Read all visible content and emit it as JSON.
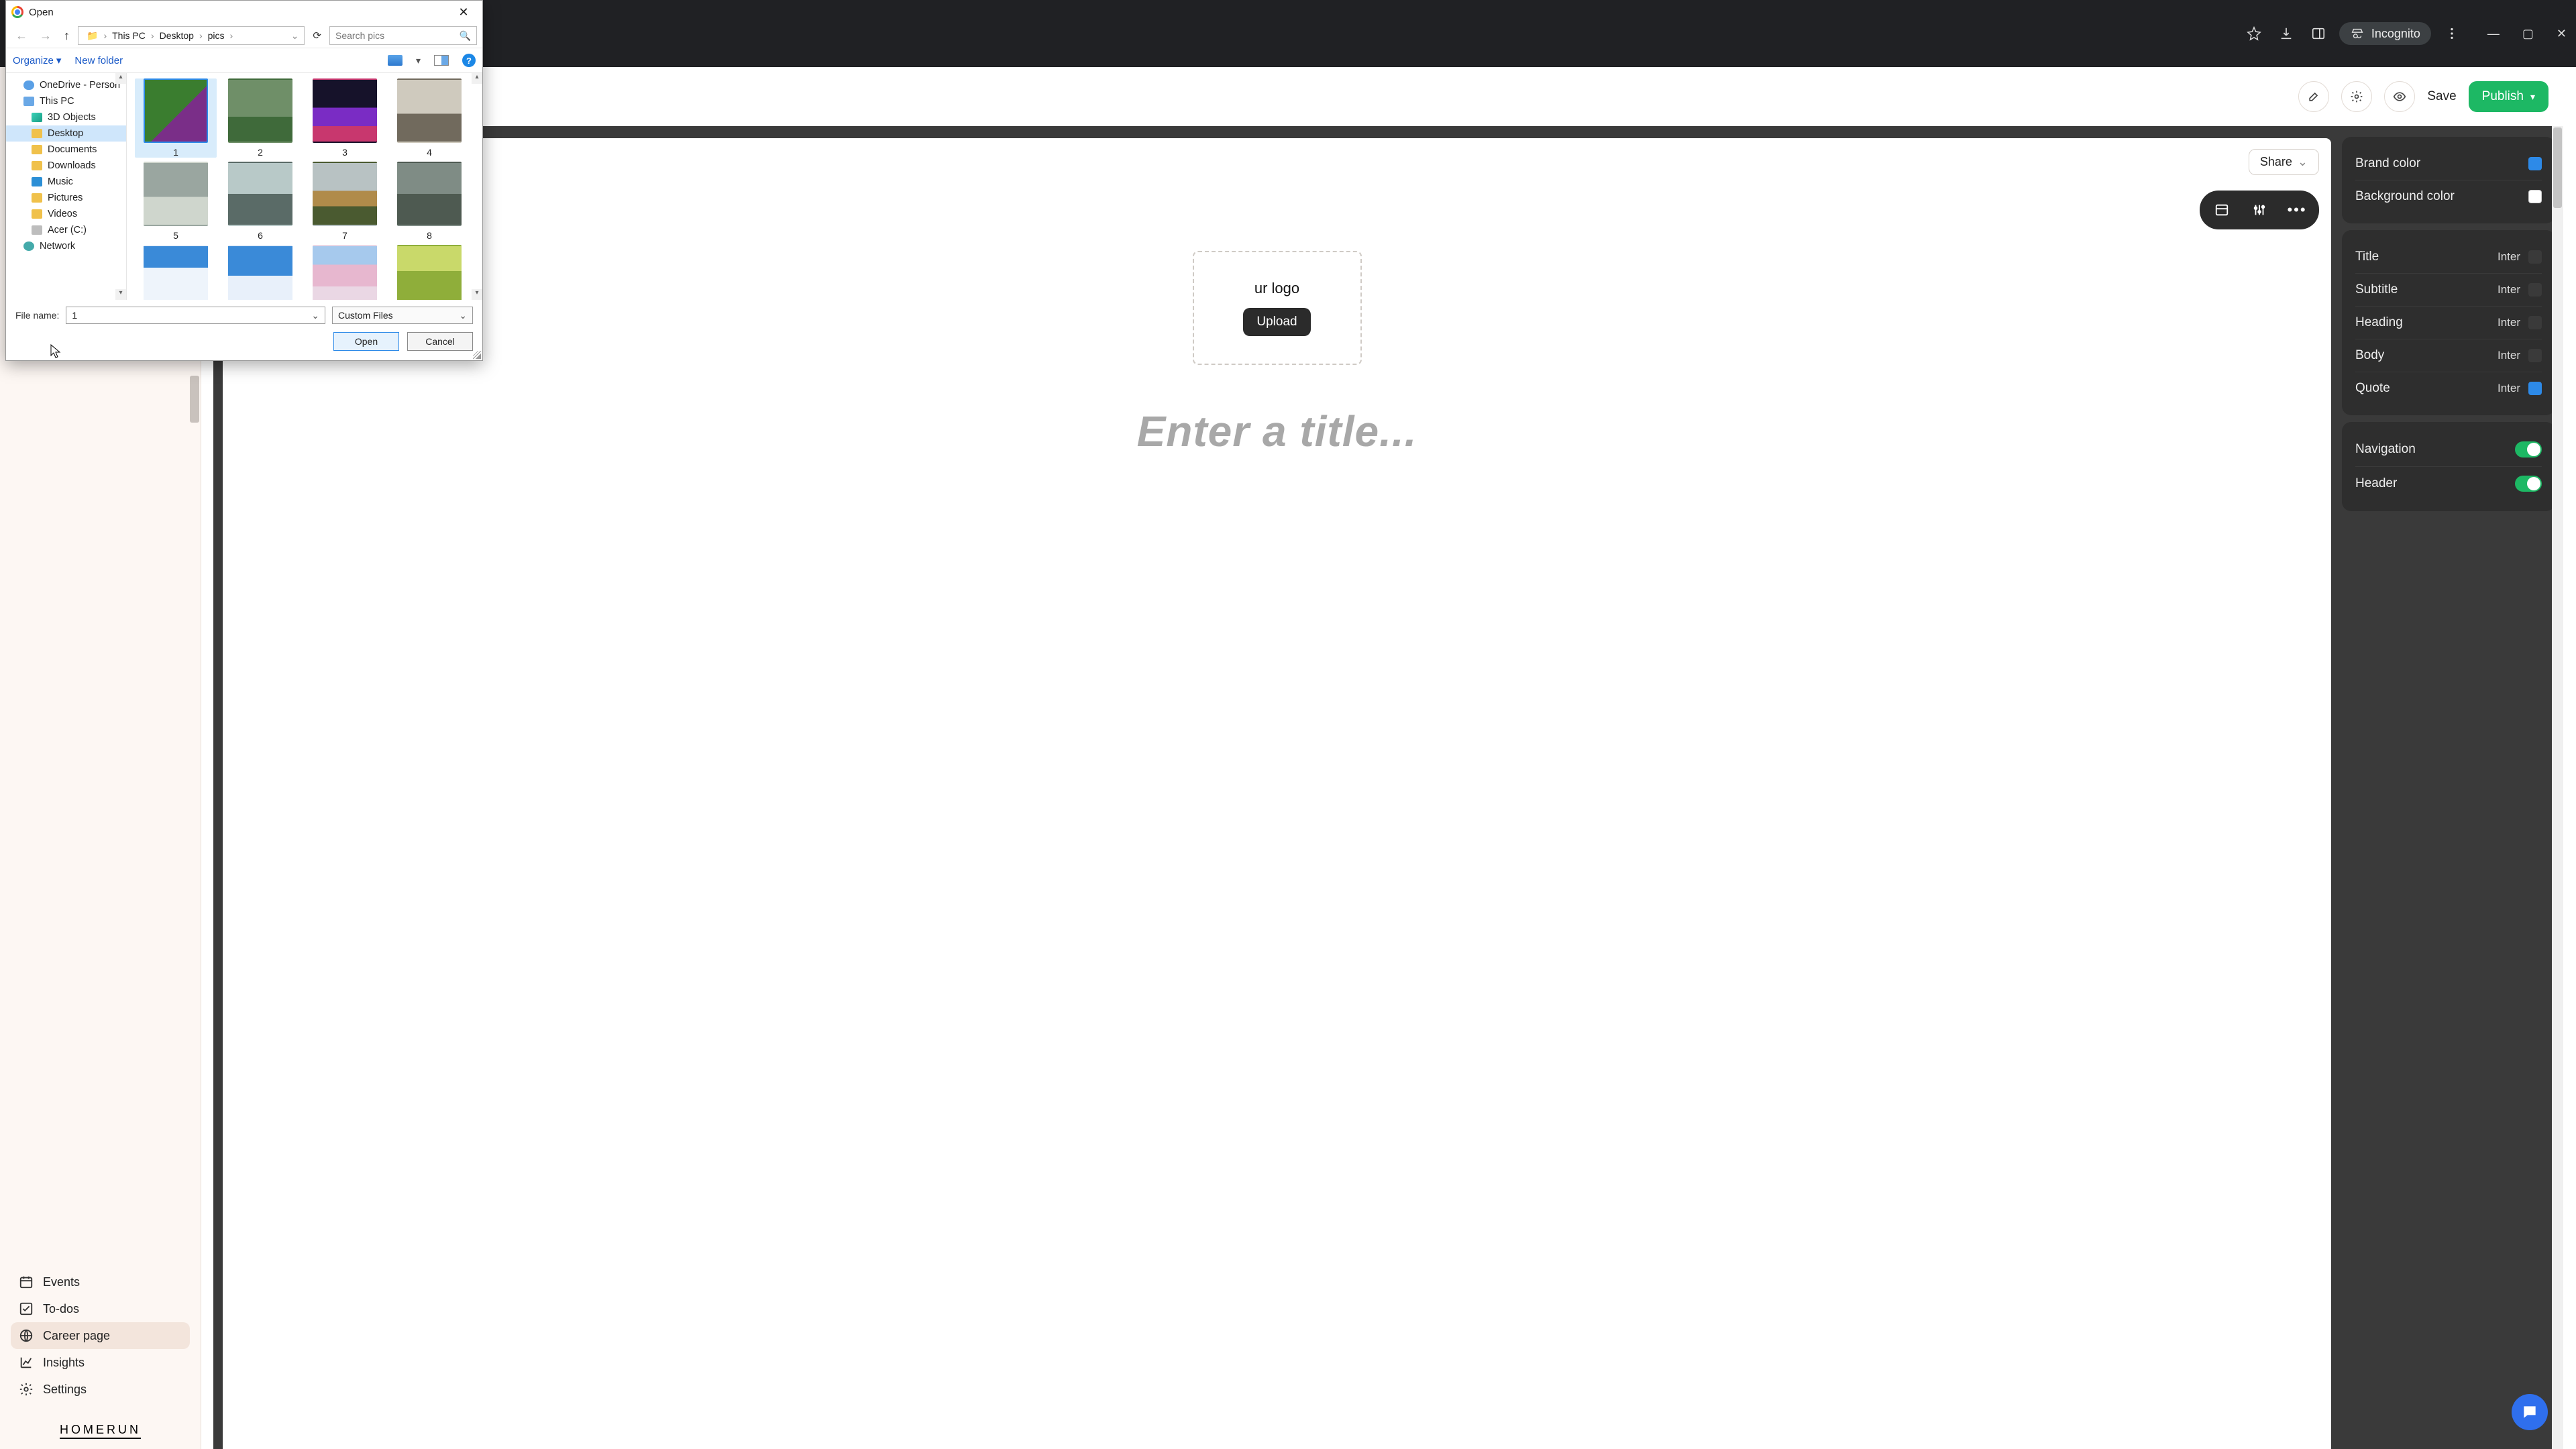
{
  "browser": {
    "incognito_label": "Incognito"
  },
  "sidebar": {
    "items": [
      {
        "label": "Events"
      },
      {
        "label": "To-dos"
      },
      {
        "label": "Career page"
      },
      {
        "label": "Insights"
      },
      {
        "label": "Settings"
      }
    ],
    "brand": "HOMERUN"
  },
  "topbar": {
    "save": "Save",
    "publish": "Publish"
  },
  "page": {
    "share": "Share",
    "logo_hint": "ur logo",
    "upload": "Upload",
    "title_placeholder": "Enter a title..."
  },
  "panel": {
    "brand_color": {
      "label": "Brand color",
      "value": "#2d8ae8"
    },
    "bg_color": {
      "label": "Background color",
      "value": "#ffffff"
    },
    "typography": [
      {
        "label": "Title",
        "font": "Inter",
        "swatch": "#3a3a3a"
      },
      {
        "label": "Subtitle",
        "font": "Inter",
        "swatch": "#3a3a3a"
      },
      {
        "label": "Heading",
        "font": "Inter",
        "swatch": "#3a3a3a"
      },
      {
        "label": "Body",
        "font": "Inter",
        "swatch": "#3a3a3a"
      },
      {
        "label": "Quote",
        "font": "Inter",
        "swatch": "#2d8ae8"
      }
    ],
    "navigation": {
      "label": "Navigation"
    },
    "header": {
      "label": "Header"
    }
  },
  "dialog": {
    "title": "Open",
    "breadcrumb": [
      "This PC",
      "Desktop",
      "pics"
    ],
    "search_placeholder": "Search pics",
    "toolbar": {
      "organize": "Organize",
      "new_folder": "New folder"
    },
    "tree": [
      {
        "label": "OneDrive - Person",
        "icon": "cloud",
        "lvl": 0
      },
      {
        "label": "This PC",
        "icon": "pc",
        "lvl": 0
      },
      {
        "label": "3D Objects",
        "icon": "obj3d",
        "lvl": 1
      },
      {
        "label": "Desktop",
        "icon": "folder",
        "lvl": 1,
        "selected": true
      },
      {
        "label": "Documents",
        "icon": "folder",
        "lvl": 1
      },
      {
        "label": "Downloads",
        "icon": "folder",
        "lvl": 1
      },
      {
        "label": "Music",
        "icon": "music",
        "lvl": 1
      },
      {
        "label": "Pictures",
        "icon": "folder",
        "lvl": 1
      },
      {
        "label": "Videos",
        "icon": "folder",
        "lvl": 1
      },
      {
        "label": "Acer (C:)",
        "icon": "disk",
        "lvl": 1
      },
      {
        "label": "Network",
        "icon": "net",
        "lvl": 0
      }
    ],
    "files": [
      {
        "name": "1",
        "cls": "p1",
        "selected": true
      },
      {
        "name": "2",
        "cls": "p2"
      },
      {
        "name": "3",
        "cls": "p3"
      },
      {
        "name": "4",
        "cls": "p4"
      },
      {
        "name": "5",
        "cls": "p5"
      },
      {
        "name": "6",
        "cls": "p6"
      },
      {
        "name": "7",
        "cls": "p7"
      },
      {
        "name": "8",
        "cls": "p8"
      },
      {
        "name": "",
        "cls": "p9"
      },
      {
        "name": "",
        "cls": "p10"
      },
      {
        "name": "",
        "cls": "p11"
      },
      {
        "name": "",
        "cls": "p12"
      }
    ],
    "file_name_label": "File name:",
    "file_name_value": "1",
    "file_type": "Custom Files",
    "open": "Open",
    "cancel": "Cancel"
  }
}
